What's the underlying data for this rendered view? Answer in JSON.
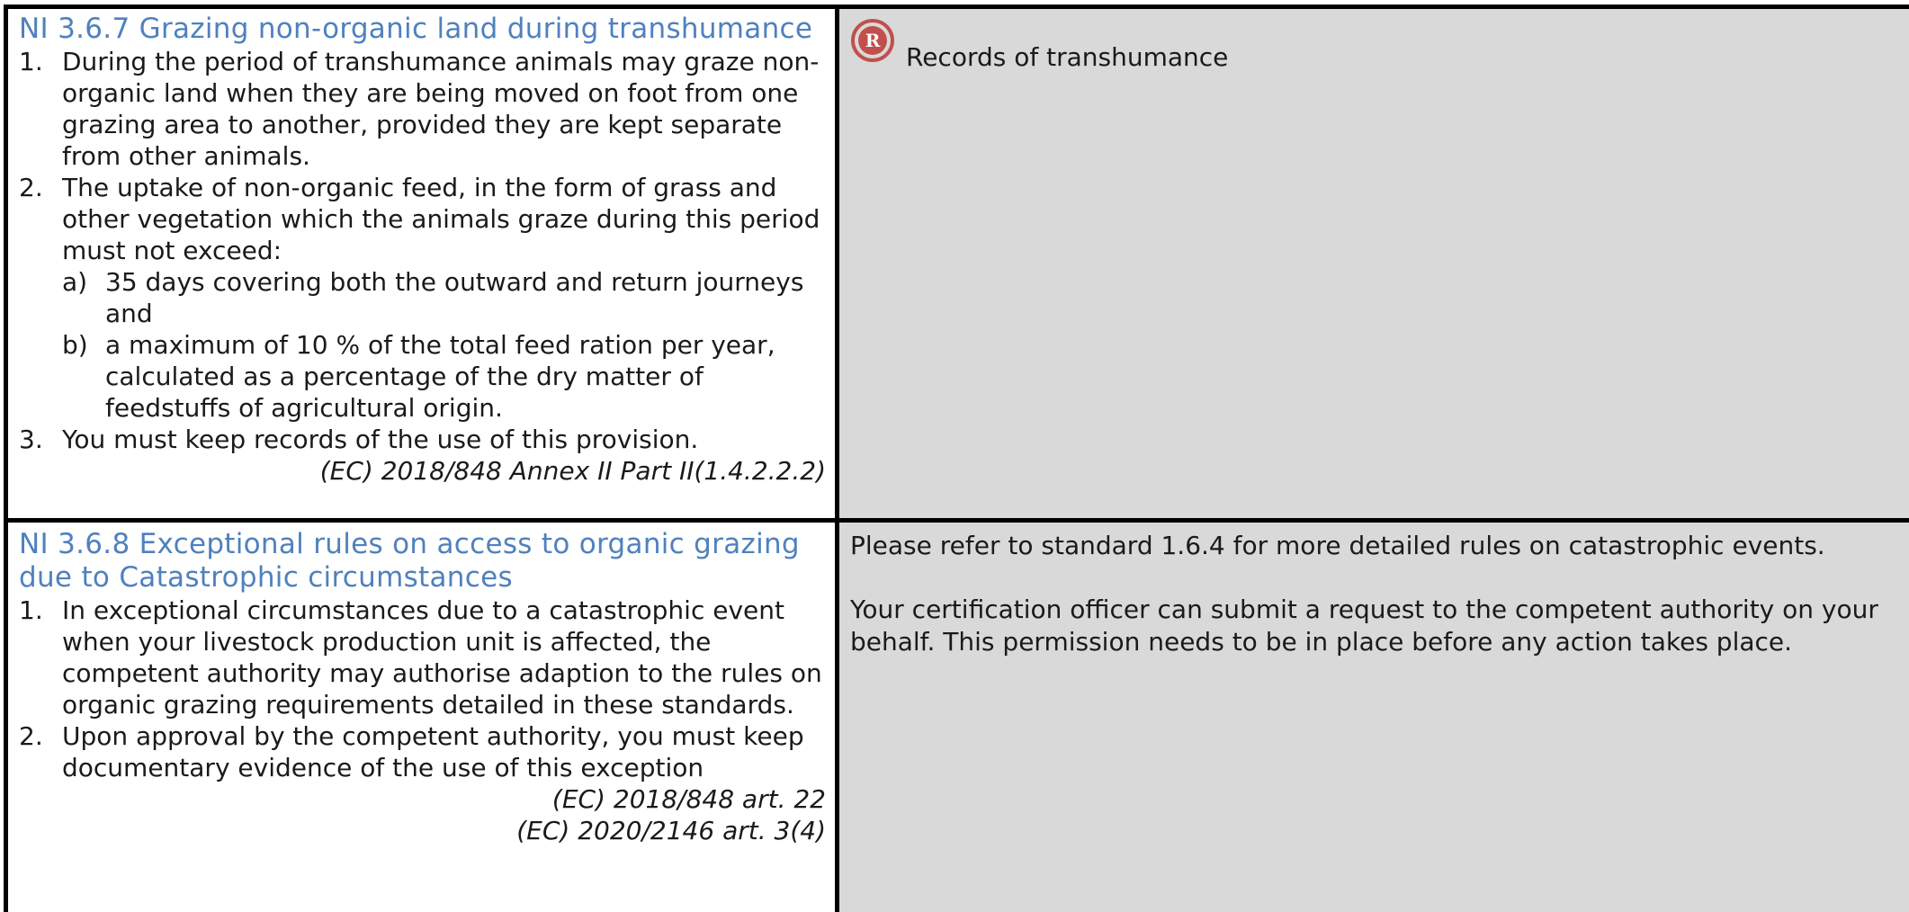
{
  "section_367": {
    "heading": "NI 3.6.7 Grazing non-organic land during transhumance",
    "items": [
      {
        "num": "1.",
        "text": "During the period of transhumance animals may graze non-organic land when they are being moved on foot from one grazing area to another, provided they are kept separate from other animals."
      },
      {
        "num": "2.",
        "text": "The uptake of non-organic feed, in the form of grass and other vegetation which the animals graze during this period must not exceed:"
      },
      {
        "num": "3.",
        "text": "You must keep records of the use of this provision."
      }
    ],
    "subitems": [
      {
        "num": "a)",
        "text": "35 days covering both the outward and return journeys and"
      },
      {
        "num": "b)",
        "text": "a maximum of 10 % of the total feed ration per year, calculated as a percentage of the dry matter of feedstuffs of agricultural origin."
      }
    ],
    "reference": "(EC) 2018/848 Annex II Part II(1.4.2.2.2)",
    "guidance": {
      "badge_letter": "R",
      "badge_color": "#c0504d",
      "icon": "record-keeping-icon",
      "text": "Records of transhumance"
    }
  },
  "section_368": {
    "heading": "NI 3.6.8 Exceptional rules on access to organic grazing due to Catastrophic circumstances",
    "items": [
      {
        "num": "1.",
        "text": "In exceptional circumstances due to a catastrophic event when your livestock production unit is affected, the competent authority may authorise adaption to the rules on organic grazing requirements detailed in these standards."
      },
      {
        "num": "2.",
        "text": "Upon approval by the competent authority, you must keep documentary evidence of the use of this exception"
      }
    ],
    "references": [
      "(EC) 2018/848 art. 22",
      "(EC) 2020/2146 art. 3(4)"
    ],
    "guidance": {
      "paragraphs": [
        "Please refer to standard 1.6.4 for more detailed rules on catastrophic events.",
        "Your certification officer can submit a request to the competent authority on your behalf. This permission needs to be in place before any action takes place."
      ]
    }
  },
  "colors": {
    "heading": "#4f81bd",
    "guidance_bg": "#d9d9d9",
    "border": "#000000"
  }
}
